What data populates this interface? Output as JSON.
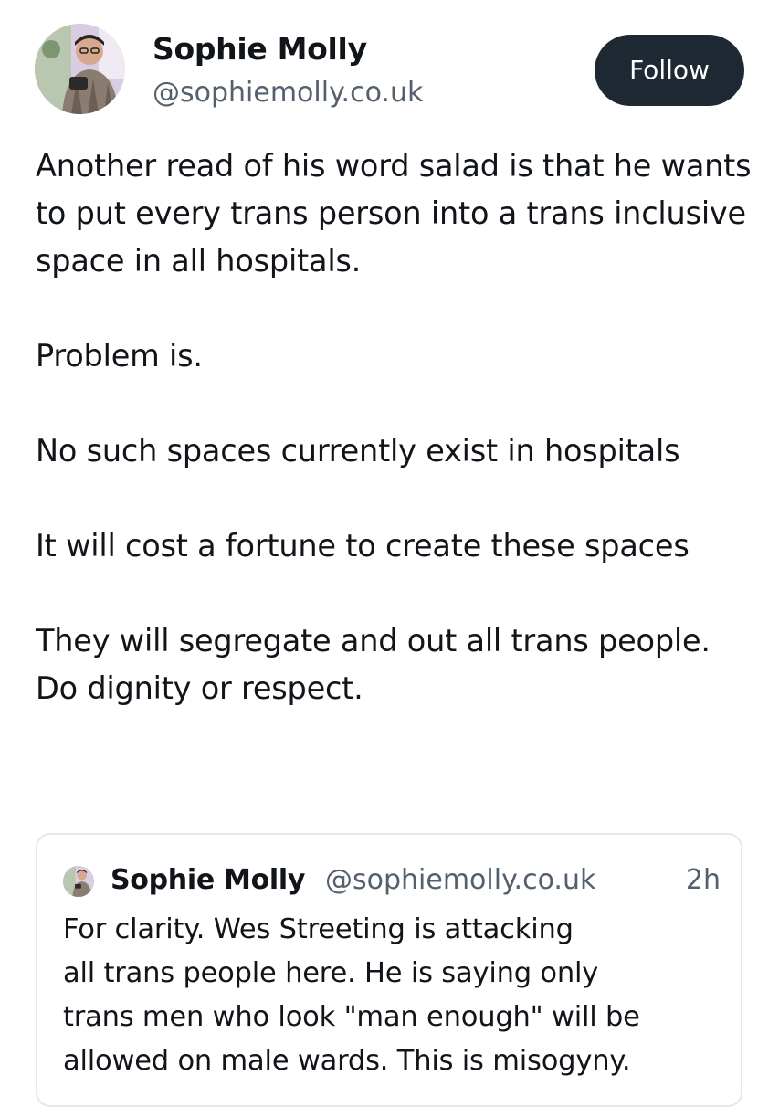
{
  "author": {
    "name": "Sophie Molly",
    "handle": "@sophiemolly.co.uk",
    "avatar_icon": "profile-photo"
  },
  "follow_label": "Follow",
  "post": {
    "paragraphs": [
      "Another read of his word salad is that he wants to put every trans person into a trans inclusive space in all hospitals.",
      "Problem is.",
      "No such spaces currently exist in hospitals",
      "It will cost a fortune to create these spaces",
      "They will segregate and out all trans people. Do dignity or respect."
    ]
  },
  "quote": {
    "author_name": "Sophie Molly",
    "author_handle": "@sophiemolly.co.uk",
    "time": "2h",
    "lines": [
      "For clarity. Wes Streeting is attacking",
      "all trans people here. He is saying only",
      "trans men who look \"man enough\" will be",
      "allowed on male wards. This is misogyny."
    ]
  },
  "colors": {
    "follow_bg": "#1f2933",
    "text": "#111418",
    "muted": "#55606e",
    "border": "#e4e8ed"
  }
}
